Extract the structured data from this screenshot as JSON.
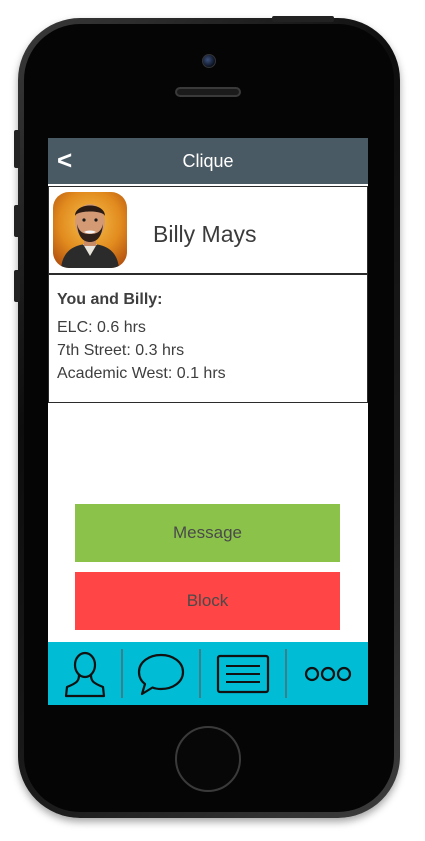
{
  "nav": {
    "back_label": "<",
    "title": "Clique"
  },
  "profile": {
    "name": "Billy Mays"
  },
  "shared_time": {
    "heading": "You and Billy:",
    "entries": [
      {
        "text": "ELC: 0.6 hrs"
      },
      {
        "text": "7th Street: 0.3 hrs"
      },
      {
        "text": "Academic West: 0.1 hrs"
      }
    ]
  },
  "actions": {
    "message_label": "Message",
    "block_label": "Block"
  },
  "tab_bar": {
    "tabs": [
      {
        "icon": "person-icon"
      },
      {
        "icon": "chat-bubble-icon"
      },
      {
        "icon": "list-icon"
      },
      {
        "icon": "more-icon"
      }
    ]
  },
  "colors": {
    "nav_background": "#4a5a64",
    "message_button": "#8bc34a",
    "block_button": "#ff4545",
    "tab_bar": "#00bcd4"
  }
}
